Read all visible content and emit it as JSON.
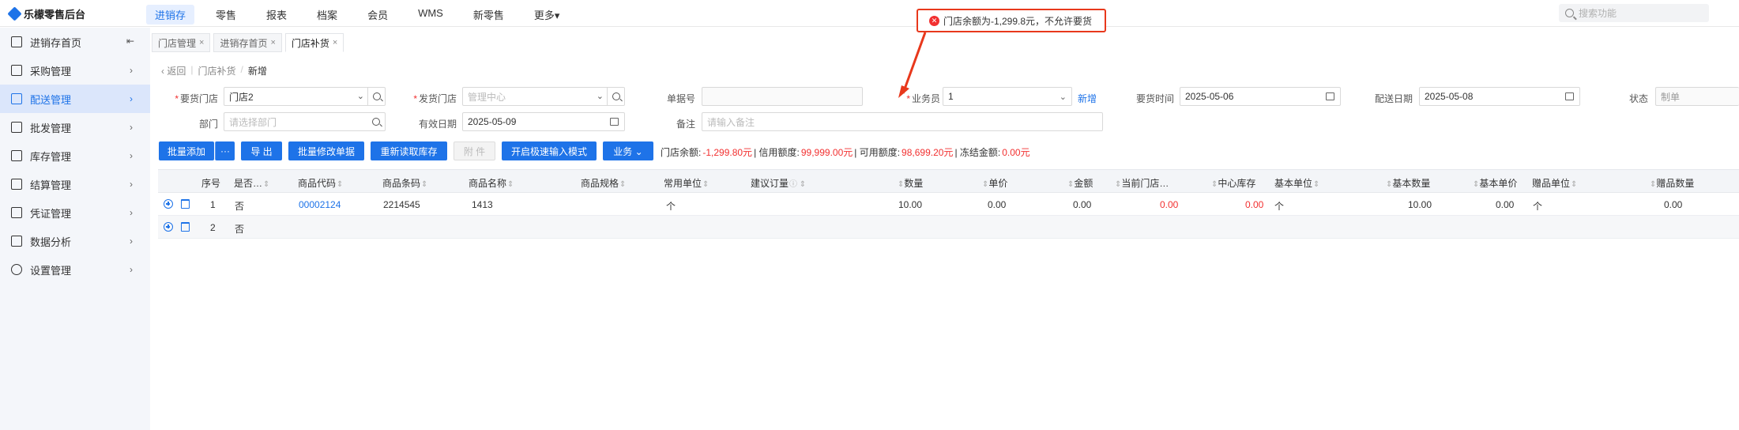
{
  "app": {
    "brand": "乐檬零售后台"
  },
  "topnav": [
    "进销存",
    "零售",
    "报表",
    "档案",
    "会员",
    "WMS",
    "新零售",
    "更多▾"
  ],
  "topsearch": {
    "placeholder": "搜索功能"
  },
  "sidebar": {
    "items": [
      {
        "label": "进销存首页",
        "icon": "home-icon"
      },
      {
        "label": "采购管理",
        "icon": "cart-icon"
      },
      {
        "label": "配送管理",
        "icon": "truck-icon"
      },
      {
        "label": "批发管理",
        "icon": "wholesale-icon"
      },
      {
        "label": "库存管理",
        "icon": "inventory-icon"
      },
      {
        "label": "结算管理",
        "icon": "settlement-icon"
      },
      {
        "label": "凭证管理",
        "icon": "voucher-icon"
      },
      {
        "label": "数据分析",
        "icon": "chart-icon"
      },
      {
        "label": "设置管理",
        "icon": "gear-icon"
      }
    ]
  },
  "tabs": [
    {
      "label": "门店管理",
      "close": "×"
    },
    {
      "label": "进销存首页",
      "close": "×"
    },
    {
      "label": "门店补货",
      "close": "×"
    }
  ],
  "breadcrumb": {
    "back": "‹ 返回",
    "parent": "门店补货",
    "sep": "/",
    "current": "新增"
  },
  "form": {
    "req_store_label": "要货门店",
    "req_store_value": "门店2",
    "ship_store_label": "发货门店",
    "ship_store_placeholder": "管理中心",
    "doc_no_label": "单据号",
    "staff_label": "业务员",
    "staff_value": "1",
    "new_link": "新增",
    "req_time_label": "要货时间",
    "req_time_value": "2025-05-06",
    "delivery_date_label": "配送日期",
    "delivery_date_value": "2025-05-08",
    "status_label": "状态",
    "status_placeholder": "制单",
    "dept_label": "部门",
    "dept_placeholder": "请选择部门",
    "valid_date_label": "有效日期",
    "valid_date_value": "2025-05-09",
    "remark_label": "备注",
    "remark_placeholder": "请输入备注"
  },
  "toolbar": {
    "batch_add": "批量添加",
    "more": "···",
    "export": "导 出",
    "batch_edit": "批量修改单据",
    "reload_stock": "重新读取库存",
    "attachment": "附 件",
    "fast_mode": "开启极速输入模式",
    "business": "业务 ⌄"
  },
  "balance": {
    "store_balance_label": "门店余额:",
    "store_balance": "-1,299.80元",
    "credit_label": "| 信用额度:",
    "credit": "99,999.00元",
    "available_label": "| 可用额度:",
    "available": "98,699.20元",
    "frozen_label": "| 冻结金额:",
    "frozen": "0.00元"
  },
  "table": {
    "headers": [
      "序号",
      "是否…",
      "商品代码",
      "商品条码",
      "商品名称",
      "商品规格",
      "常用单位",
      "建议订量",
      "数量",
      "单价",
      "金额",
      "当前门店…",
      "中心库存",
      "基本单位",
      "基本数量",
      "基本单价",
      "赠品单位",
      "赠品数量"
    ],
    "rows": [
      {
        "seq": "1",
        "flag": "否",
        "code": "00002124",
        "barcode": "2214545",
        "name": "1413",
        "spec": "",
        "unit": "个",
        "suggest": "",
        "qty": "10.00",
        "price": "0.00",
        "amount": "0.00",
        "store_stock": "0.00",
        "center_stock": "0.00",
        "base_unit": "个",
        "base_qty": "10.00",
        "base_price": "0.00",
        "gift_unit": "个",
        "gift_qty": "0.00"
      },
      {
        "seq": "2",
        "flag": "否"
      }
    ]
  },
  "toast": {
    "message": "门店余额为-1,299.8元，不允许要货"
  },
  "colors": {
    "accent": "#1e73e8",
    "error": "#f23030",
    "annotation": "#e8381c"
  }
}
